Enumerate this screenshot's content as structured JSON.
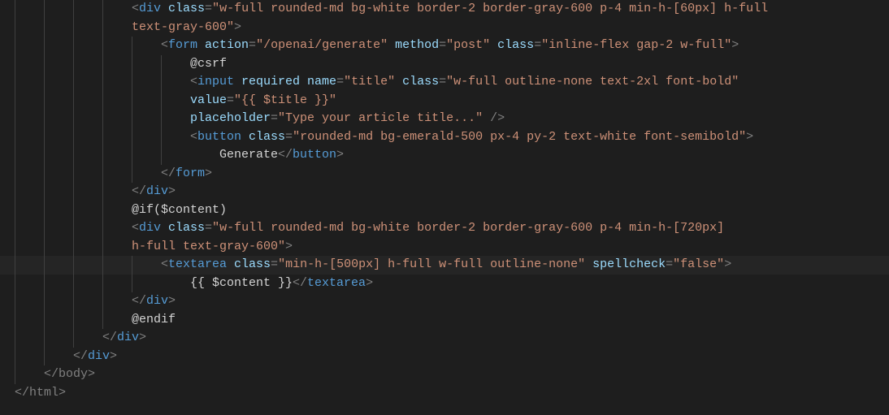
{
  "lines": [
    {
      "indentGuides": 4,
      "extraPad": 0,
      "segs": [
        {
          "t": "<",
          "c": "pun"
        },
        {
          "t": "div ",
          "c": "tag"
        },
        {
          "t": "class",
          "c": "attr"
        },
        {
          "t": "=",
          "c": "pun"
        },
        {
          "t": "\"w-full rounded-md bg-white border-2 border-gray-600 p-4 min-h-[60px] h-full ",
          "c": "str"
        }
      ]
    },
    {
      "indentGuides": 4,
      "extraPad": 0,
      "segs": [
        {
          "t": "text-gray-600\"",
          "c": "str"
        },
        {
          "t": ">",
          "c": "pun"
        }
      ]
    },
    {
      "indentGuides": 5,
      "extraPad": 0,
      "segs": [
        {
          "t": "<",
          "c": "pun"
        },
        {
          "t": "form ",
          "c": "tag"
        },
        {
          "t": "action",
          "c": "attr"
        },
        {
          "t": "=",
          "c": "pun"
        },
        {
          "t": "\"/openai/generate\"",
          "c": "str"
        },
        {
          "t": " ",
          "c": "txt"
        },
        {
          "t": "method",
          "c": "attr"
        },
        {
          "t": "=",
          "c": "pun"
        },
        {
          "t": "\"post\"",
          "c": "str"
        },
        {
          "t": " ",
          "c": "txt"
        },
        {
          "t": "class",
          "c": "attr"
        },
        {
          "t": "=",
          "c": "pun"
        },
        {
          "t": "\"inline-flex gap-2 w-full\"",
          "c": "str"
        },
        {
          "t": ">",
          "c": "pun"
        }
      ]
    },
    {
      "indentGuides": 6,
      "extraPad": 0,
      "segs": [
        {
          "t": "@csrf",
          "c": "dir"
        }
      ]
    },
    {
      "indentGuides": 6,
      "extraPad": 0,
      "segs": [
        {
          "t": "<",
          "c": "pun"
        },
        {
          "t": "input ",
          "c": "tag"
        },
        {
          "t": "required ",
          "c": "attr"
        },
        {
          "t": "name",
          "c": "attr"
        },
        {
          "t": "=",
          "c": "pun"
        },
        {
          "t": "\"title\"",
          "c": "str"
        },
        {
          "t": " ",
          "c": "txt"
        },
        {
          "t": "class",
          "c": "attr"
        },
        {
          "t": "=",
          "c": "pun"
        },
        {
          "t": "\"w-full outline-none text-2xl font-bold\"",
          "c": "str"
        }
      ]
    },
    {
      "indentGuides": 6,
      "extraPad": 0,
      "segs": [
        {
          "t": "value",
          "c": "attr"
        },
        {
          "t": "=",
          "c": "pun"
        },
        {
          "t": "\"{{ $title }}\"",
          "c": "str"
        }
      ]
    },
    {
      "indentGuides": 6,
      "extraPad": 0,
      "segs": [
        {
          "t": "placeholder",
          "c": "attr"
        },
        {
          "t": "=",
          "c": "pun"
        },
        {
          "t": "\"Type your article title...\"",
          "c": "str"
        },
        {
          "t": " />",
          "c": "pun"
        }
      ]
    },
    {
      "indentGuides": 6,
      "extraPad": 0,
      "segs": [
        {
          "t": "<",
          "c": "pun"
        },
        {
          "t": "button ",
          "c": "tag"
        },
        {
          "t": "class",
          "c": "attr"
        },
        {
          "t": "=",
          "c": "pun"
        },
        {
          "t": "\"rounded-md bg-emerald-500 px-4 py-2 text-white font-semibold\"",
          "c": "str"
        },
        {
          "t": ">",
          "c": "pun"
        }
      ]
    },
    {
      "indentGuides": 6,
      "extraPad": 36,
      "segs": [
        {
          "t": "Generate",
          "c": "txt"
        },
        {
          "t": "</",
          "c": "pun"
        },
        {
          "t": "button",
          "c": "tag"
        },
        {
          "t": ">",
          "c": "pun"
        }
      ]
    },
    {
      "indentGuides": 5,
      "extraPad": 0,
      "segs": [
        {
          "t": "</",
          "c": "pun"
        },
        {
          "t": "form",
          "c": "tag"
        },
        {
          "t": ">",
          "c": "pun"
        }
      ]
    },
    {
      "indentGuides": 4,
      "extraPad": 0,
      "segs": [
        {
          "t": "</",
          "c": "pun"
        },
        {
          "t": "div",
          "c": "tag"
        },
        {
          "t": ">",
          "c": "pun"
        }
      ]
    },
    {
      "indentGuides": 4,
      "extraPad": 0,
      "segs": [
        {
          "t": "@if($content)",
          "c": "dir"
        }
      ]
    },
    {
      "indentGuides": 4,
      "extraPad": 0,
      "segs": [
        {
          "t": "<",
          "c": "pun"
        },
        {
          "t": "div ",
          "c": "tag"
        },
        {
          "t": "class",
          "c": "attr"
        },
        {
          "t": "=",
          "c": "pun"
        },
        {
          "t": "\"w-full rounded-md bg-white border-2 border-gray-600 p-4 min-h-[720px] ",
          "c": "str"
        }
      ]
    },
    {
      "indentGuides": 4,
      "extraPad": 0,
      "segs": [
        {
          "t": "h-full text-gray-600\"",
          "c": "str"
        },
        {
          "t": ">",
          "c": "pun"
        }
      ]
    },
    {
      "indentGuides": 5,
      "extraPad": 0,
      "current": true,
      "segs": [
        {
          "t": "<",
          "c": "pun"
        },
        {
          "t": "textarea ",
          "c": "tag"
        },
        {
          "t": "class",
          "c": "attr"
        },
        {
          "t": "=",
          "c": "pun"
        },
        {
          "t": "\"min-h-[500px] h-full w-full outline-none\"",
          "c": "str"
        },
        {
          "t": " ",
          "c": "txt"
        },
        {
          "t": "spellcheck",
          "c": "attr"
        },
        {
          "t": "=",
          "c": "pun"
        },
        {
          "t": "\"false\"",
          "c": "str"
        },
        {
          "t": ">",
          "c": "pun"
        }
      ]
    },
    {
      "indentGuides": 5,
      "extraPad": 36,
      "segs": [
        {
          "t": "{{ $content }}",
          "c": "txt"
        },
        {
          "t": "</",
          "c": "pun"
        },
        {
          "t": "textarea",
          "c": "tag"
        },
        {
          "t": ">",
          "c": "pun"
        }
      ]
    },
    {
      "indentGuides": 4,
      "extraPad": 0,
      "segs": [
        {
          "t": "</",
          "c": "pun"
        },
        {
          "t": "div",
          "c": "tag"
        },
        {
          "t": ">",
          "c": "pun"
        }
      ]
    },
    {
      "indentGuides": 4,
      "extraPad": 0,
      "segs": [
        {
          "t": "@endif",
          "c": "dir"
        }
      ]
    },
    {
      "indentGuides": 3,
      "extraPad": 0,
      "segs": [
        {
          "t": "</",
          "c": "pun"
        },
        {
          "t": "div",
          "c": "tag"
        },
        {
          "t": ">",
          "c": "pun"
        }
      ]
    },
    {
      "indentGuides": 2,
      "extraPad": 0,
      "segs": [
        {
          "t": "</",
          "c": "pun"
        },
        {
          "t": "div",
          "c": "tag"
        },
        {
          "t": ">",
          "c": "pun"
        }
      ]
    },
    {
      "indentGuides": 1,
      "extraPad": 0,
      "segs": [
        {
          "t": "</",
          "c": "pun"
        },
        {
          "t": "body",
          "c": "struct-tag"
        },
        {
          "t": ">",
          "c": "pun"
        }
      ]
    },
    {
      "indentGuides": 0,
      "extraPad": 0,
      "segs": [
        {
          "t": "</",
          "c": "pun"
        },
        {
          "t": "html",
          "c": "struct-tag"
        },
        {
          "t": ">",
          "c": "pun"
        }
      ]
    }
  ],
  "guideCols": 6,
  "indentWidth": 36,
  "glyphMarginWidth": 18
}
